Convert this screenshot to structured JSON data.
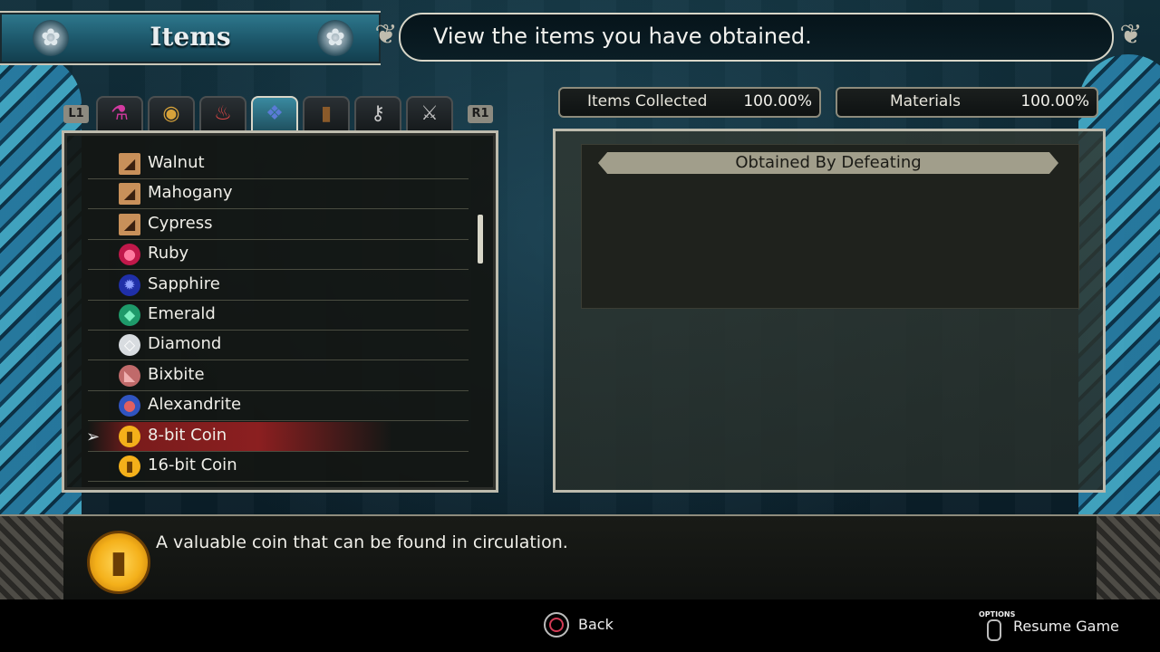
{
  "header": {
    "title": "Items",
    "hint": "View the items you have obtained."
  },
  "tabs": {
    "left_shoulder": "L1",
    "right_shoulder": "R1",
    "items": [
      {
        "name": "potions-tab",
        "icon": "potion-icon",
        "glyph": "⚗",
        "color": "#d33aa0"
      },
      {
        "name": "food-tab",
        "icon": "plate-icon",
        "glyph": "◉",
        "color": "#d6a23a"
      },
      {
        "name": "sushi-tab",
        "icon": "sushi-icon",
        "glyph": "♨",
        "color": "#e04848"
      },
      {
        "name": "materials-tab",
        "icon": "gem-pile-icon",
        "glyph": "❖",
        "color": "#5a7bd6"
      },
      {
        "name": "books-tab",
        "icon": "book-icon",
        "glyph": "▮",
        "color": "#8a5a2a"
      },
      {
        "name": "keys-tab",
        "icon": "key-icon",
        "glyph": "⚷",
        "color": "#c8c8c8"
      },
      {
        "name": "weapons-tab",
        "icon": "crossed-swords-icon",
        "glyph": "⚔",
        "color": "#c0c0c0"
      }
    ]
  },
  "stats": {
    "items_collected_label": "Items Collected",
    "items_collected_value": "100.00%",
    "materials_label": "Materials",
    "materials_value": "100.00%"
  },
  "list": {
    "items": [
      {
        "label": "Walnut",
        "icon": "wood-icon",
        "glyph": "◢",
        "color": "#c8905a",
        "fg": "#3a2010"
      },
      {
        "label": "Mahogany",
        "icon": "wood-icon",
        "glyph": "◢",
        "color": "#c8905a",
        "fg": "#3a2010"
      },
      {
        "label": "Cypress",
        "icon": "wood-icon",
        "glyph": "◢",
        "color": "#c8905a",
        "fg": "#3a2010"
      },
      {
        "label": "Ruby",
        "icon": "ruby-icon",
        "glyph": "●",
        "color": "#c0184a",
        "fg": "#ff7aa0"
      },
      {
        "label": "Sapphire",
        "icon": "sapphire-icon",
        "glyph": "✹",
        "color": "#1f2fa8",
        "fg": "#8ea0ff"
      },
      {
        "label": "Emerald",
        "icon": "emerald-icon",
        "glyph": "◆",
        "color": "#1e9a6a",
        "fg": "#7df0c0"
      },
      {
        "label": "Diamond",
        "icon": "diamond-icon",
        "glyph": "◇",
        "color": "#d8dce0",
        "fg": "#ffffff"
      },
      {
        "label": "Bixbite",
        "icon": "bixbite-icon",
        "glyph": "◣",
        "color": "#c06a6a",
        "fg": "#f0b0b0"
      },
      {
        "label": "Alexandrite",
        "icon": "alexandrite-icon",
        "glyph": "●",
        "color": "#3054c0",
        "fg": "#e06060"
      },
      {
        "label": "8-bit Coin",
        "icon": "coin-icon",
        "glyph": "▮",
        "color": "#f4b01a",
        "fg": "#6a3e05"
      },
      {
        "label": "16-bit Coin",
        "icon": "coin-icon",
        "glyph": "▮",
        "color": "#f4b01a",
        "fg": "#6a3e05"
      }
    ],
    "selected_index": 9
  },
  "detail": {
    "obtained_by_label": "Obtained By Defeating"
  },
  "description": {
    "text": "A valuable coin that can be found in circulation.",
    "icon": "coin-icon"
  },
  "footer": {
    "back_label": "Back",
    "options_label": "OPTIONS",
    "resume_label": "Resume Game"
  }
}
